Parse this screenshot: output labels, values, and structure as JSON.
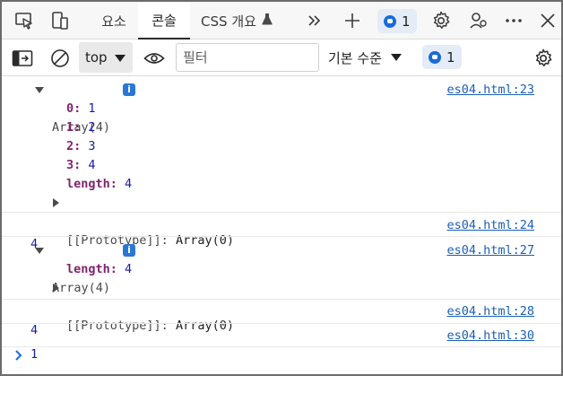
{
  "tabs": {
    "elements": "요소",
    "console": "콘솔",
    "css_overview": "CSS 개요",
    "issues_badge": "1"
  },
  "toolbar": {
    "context": "top",
    "filter_placeholder": "필터",
    "levels": "기본 수준",
    "issues_badge": "1"
  },
  "entries": [
    {
      "header": "Array(4)",
      "source": "es04.html:23",
      "props": [
        {
          "key": "0",
          "value": "1"
        },
        {
          "key": "1",
          "value": "2"
        },
        {
          "key": "2",
          "value": "3"
        },
        {
          "key": "3",
          "value": "4"
        },
        {
          "key": "length",
          "value": "4"
        }
      ],
      "proto_key": "[[Prototype]]",
      "proto_value": "Array(0)"
    },
    {
      "value": "4",
      "source": "es04.html:24"
    },
    {
      "header": "Array(4)",
      "source": "es04.html:27",
      "props": [
        {
          "key": "length",
          "value": "4"
        }
      ],
      "proto_key": "[[Prototype]]",
      "proto_value": "Array(0)"
    },
    {
      "value": "4",
      "source": "es04.html:28"
    },
    {
      "value": "1",
      "source": "es04.html:30"
    }
  ],
  "icons": {
    "inspect": "inspect-element-icon",
    "device": "device-emulation-icon",
    "flask": "flask-icon",
    "more_tabs": "chevrons-right-icon",
    "add": "plus-icon",
    "settings": "gear-icon",
    "customize": "customize-icon",
    "menu": "ellipsis-icon",
    "close": "close-icon",
    "sidebar": "sidebar-toggle-icon",
    "clear": "clear-console-icon",
    "eye": "live-expression-icon"
  },
  "colors": {
    "accent": "#1a6ad8",
    "link": "#1a5fb4",
    "key": "#80236d",
    "number": "#1a1aa6"
  }
}
